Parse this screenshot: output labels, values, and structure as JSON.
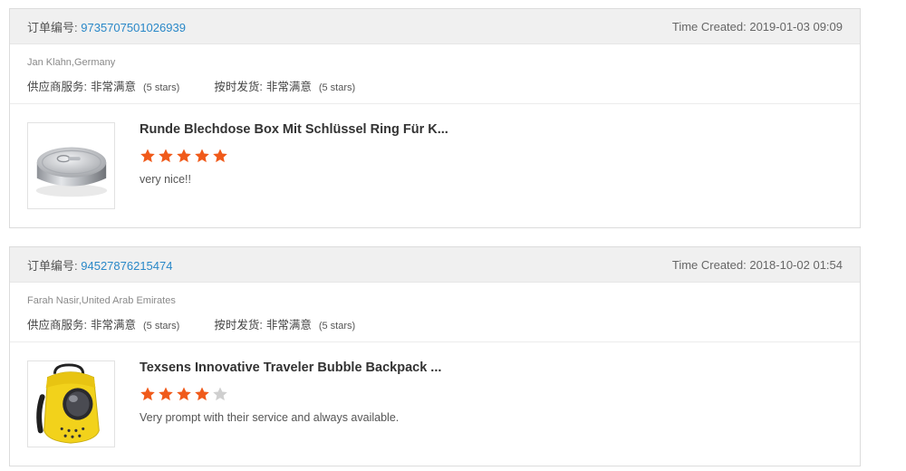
{
  "orders": [
    {
      "order_no_label": "订单编号:",
      "order_no": "9735707501026939",
      "time_created": "Time Created: 2019-01-03 09:09",
      "buyer": "Jan Klahn,Germany",
      "ratings": [
        {
          "label": "供应商服务:",
          "value": "非常满意",
          "stars_note": "(5 stars)"
        },
        {
          "label": "按时发货:",
          "value": "非常满意",
          "stars_note": "(5 stars)"
        }
      ],
      "product": {
        "title": "Runde Blechdose Box Mit Schlüssel Ring Für K...",
        "rating": 5,
        "rating_max": 5,
        "review": "very nice!!",
        "thumbnail_icon": "tin-can-icon"
      }
    },
    {
      "order_no_label": "订单编号:",
      "order_no": "94527876215474",
      "time_created": "Time Created: 2018-10-02 01:54",
      "buyer": "Farah Nasir,United Arab Emirates",
      "ratings": [
        {
          "label": "供应商服务:",
          "value": "非常满意",
          "stars_note": "(5 stars)"
        },
        {
          "label": "按时发货:",
          "value": "非常满意",
          "stars_note": "(5 stars)"
        }
      ],
      "product": {
        "title": "Texsens Innovative Traveler Bubble Backpack ...",
        "rating": 4,
        "rating_max": 5,
        "review": "Very prompt with their service and always available.",
        "thumbnail_icon": "bubble-backpack-icon"
      }
    }
  ],
  "colors": {
    "link": "#2a88c8",
    "star_filled": "#f05a1a",
    "star_empty": "#cfcfcf",
    "header_bg": "#f0f0f0"
  }
}
